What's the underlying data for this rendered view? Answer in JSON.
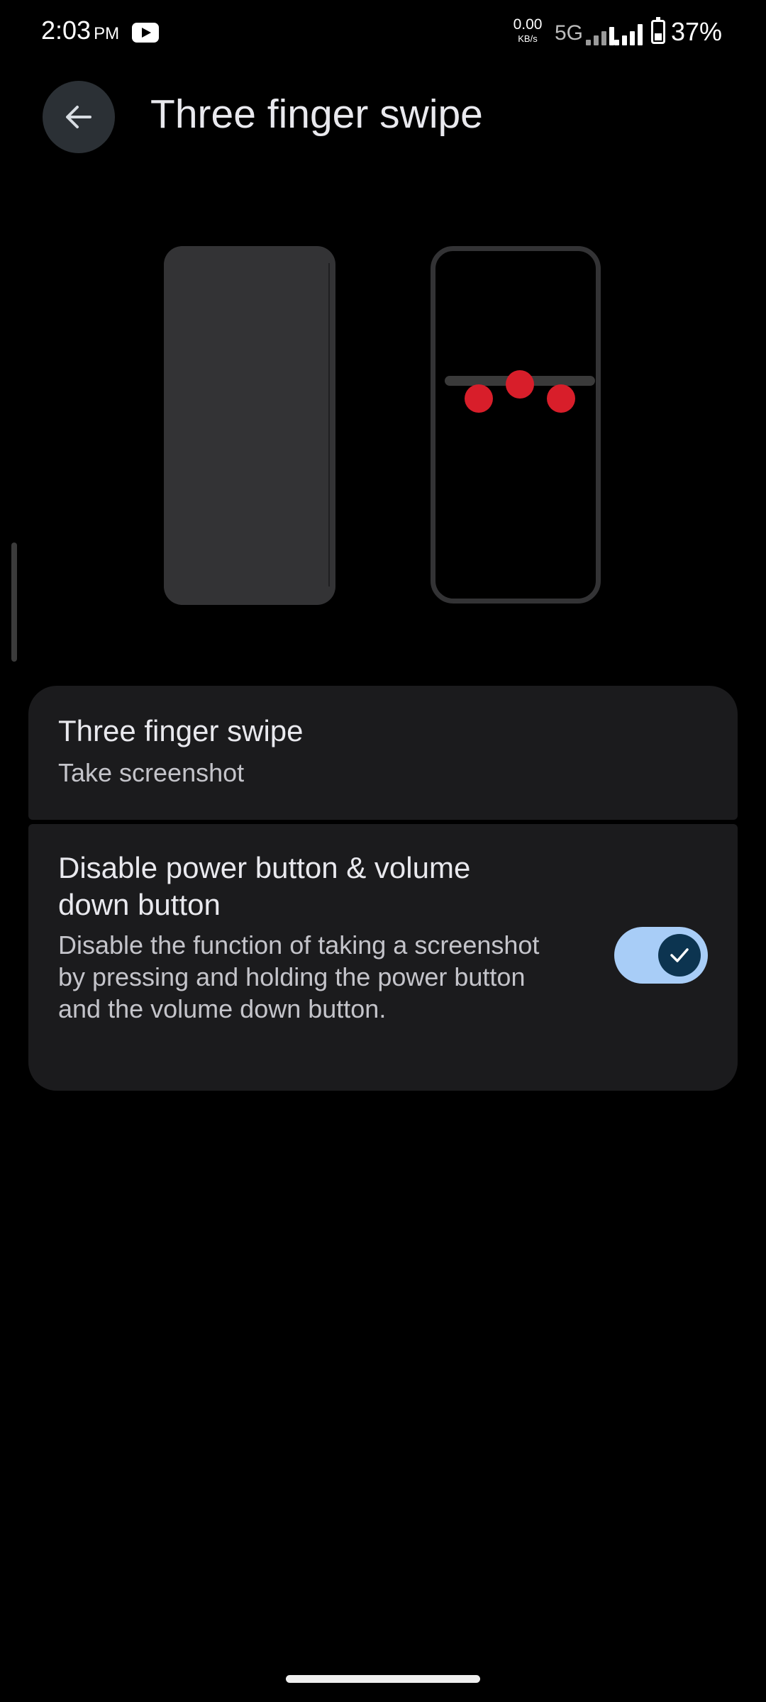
{
  "status_bar": {
    "time": "2:03",
    "ampm": "PM",
    "app_icon": "youtube-icon",
    "net_speed_value": "0.00",
    "net_speed_unit": "KB/s",
    "network_type": "5G",
    "signal_icon": "cell-signal-icon",
    "battery_icon": "battery-icon",
    "battery_percent": "37%"
  },
  "header": {
    "back_icon": "arrow-back-icon",
    "title": "Three finger swipe"
  },
  "illustration": {
    "dot_color": "#d81e2a",
    "frame_color": "#333335"
  },
  "settings": {
    "swipe_item": {
      "title": "Three finger swipe",
      "subtitle": "Take screenshot"
    },
    "disable_item": {
      "title": "Disable power button & volume down button",
      "description": "Disable the function of taking a screenshot by pressing and holding the power button and the volume down button.",
      "enabled": true,
      "check_icon": "check-icon"
    }
  },
  "colors": {
    "background": "#000000",
    "card": "#1b1b1d",
    "toggle_track": "#a8cdf7",
    "toggle_knob": "#0c3450"
  }
}
